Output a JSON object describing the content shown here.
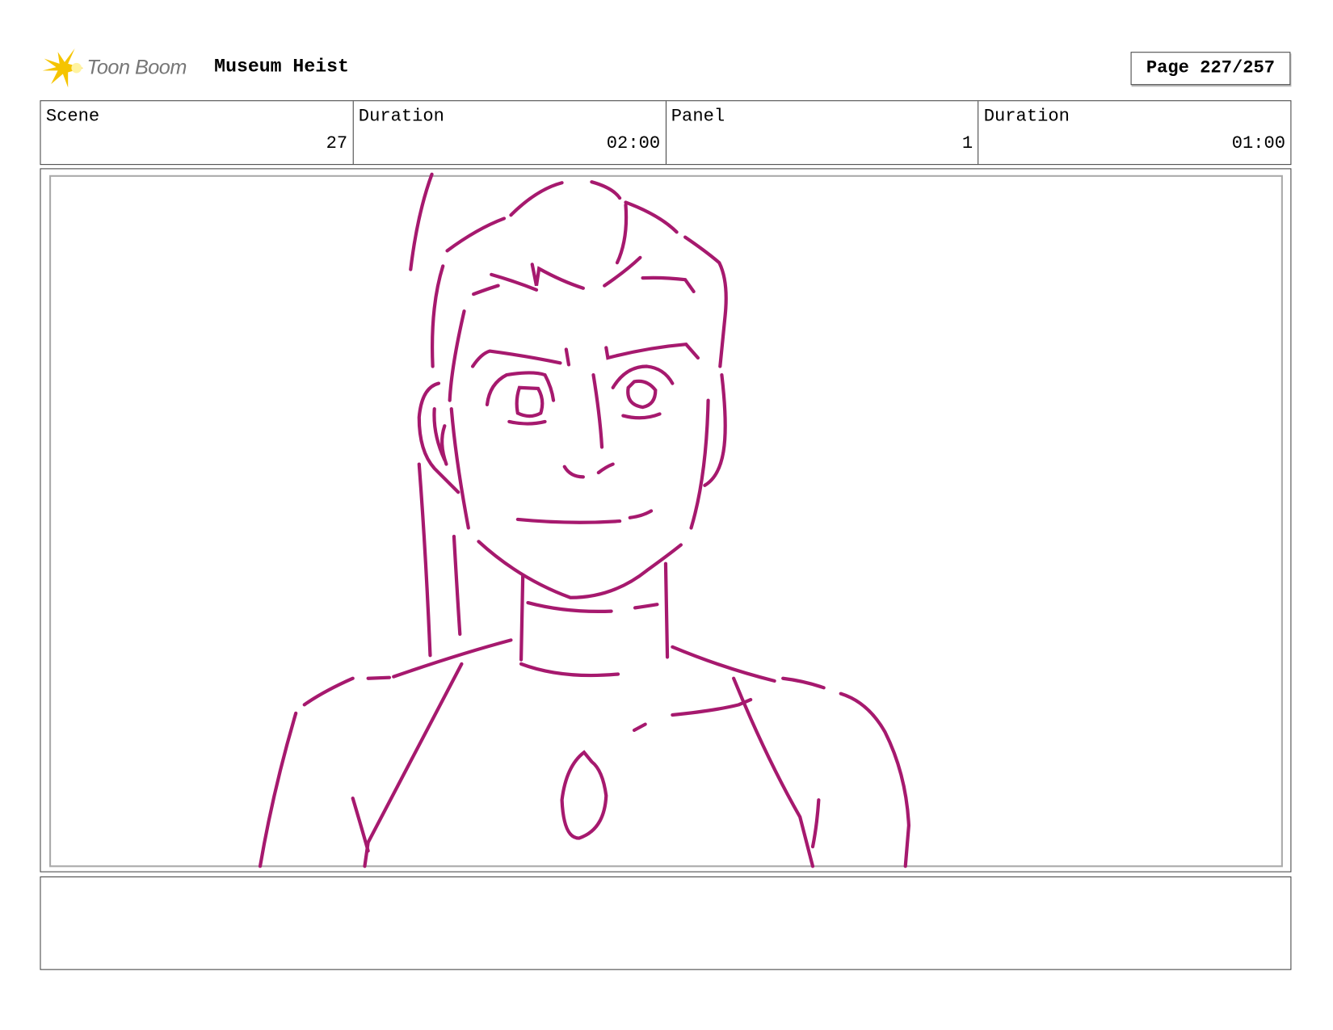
{
  "header": {
    "logo_text": "Toon Boom",
    "project_title": "Museum Heist",
    "page_label": "Page 227/257"
  },
  "info": [
    {
      "label": "Scene",
      "value": "27"
    },
    {
      "label": "Duration",
      "value": "02:00"
    },
    {
      "label": "Panel",
      "value": "1"
    },
    {
      "label": "Duration",
      "value": "01:00"
    }
  ],
  "colors": {
    "sketch_stroke": "#a6196e",
    "logo_star": "#f5c400"
  },
  "notes": ""
}
